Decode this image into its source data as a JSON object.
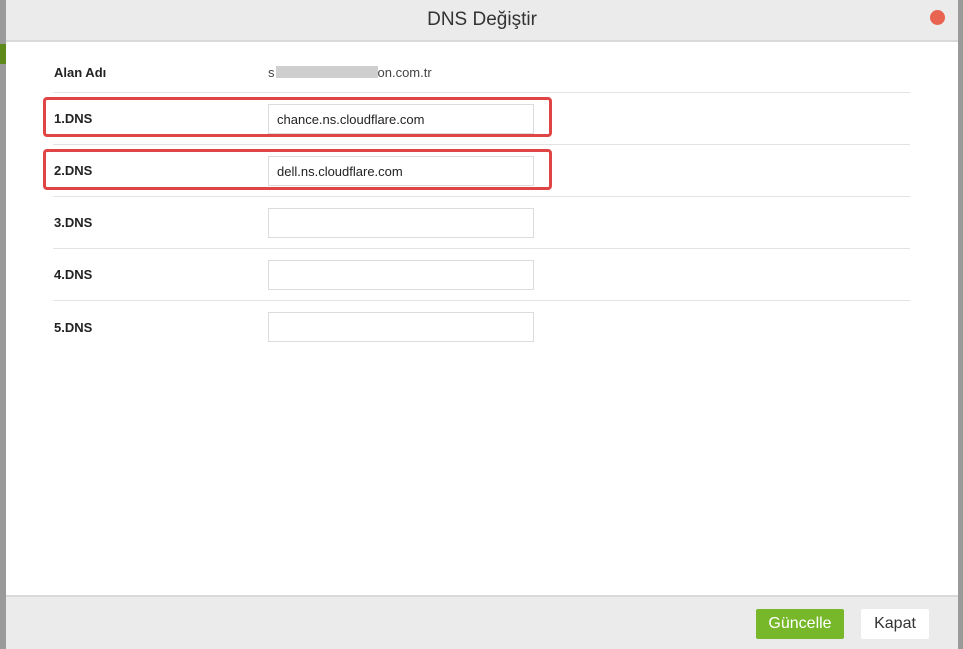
{
  "dialog": {
    "title": "DNS Değiştir"
  },
  "domain": {
    "label": "Alan Adı",
    "prefix": "s",
    "suffix": "on.com.tr"
  },
  "dns_rows": [
    {
      "label": "1.DNS",
      "value": "chance.ns.cloudflare.com",
      "placeholder": ""
    },
    {
      "label": "2.DNS",
      "value": "dell.ns.cloudflare.com",
      "placeholder": ""
    },
    {
      "label": "3.DNS",
      "value": "",
      "placeholder": ""
    },
    {
      "label": "4.DNS",
      "value": "",
      "placeholder": ""
    },
    {
      "label": "5.DNS",
      "value": "",
      "placeholder": ""
    }
  ],
  "footer": {
    "update_label": "Güncelle",
    "close_label": "Kapat"
  },
  "colors": {
    "accent_green": "#76b82a",
    "highlight_red": "#e04545",
    "close_dot": "#e86350"
  }
}
